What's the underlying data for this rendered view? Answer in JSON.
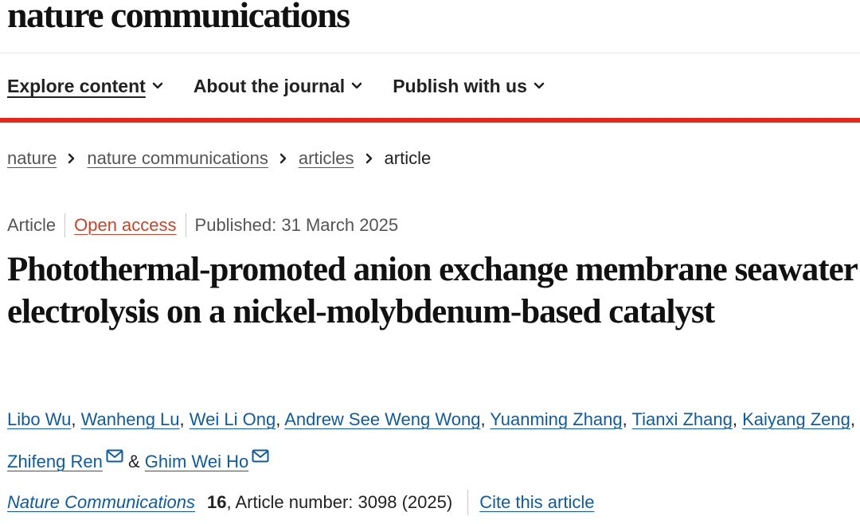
{
  "site": {
    "logo_text": "nature communications"
  },
  "nav": {
    "items": [
      {
        "label": "Explore content",
        "icon": "chevron-down-icon"
      },
      {
        "label": "About the journal",
        "icon": "chevron-down-icon"
      },
      {
        "label": "Publish with us",
        "icon": "chevron-down-icon"
      }
    ]
  },
  "breadcrumb": {
    "items": [
      "nature",
      "nature communications",
      "articles"
    ],
    "current": "article",
    "separator_icon": "chevron-right-icon"
  },
  "article": {
    "type": "Article",
    "access": "Open access",
    "published": "Published: 31 March 2025",
    "title": "Photothermal-promoted anion exchange membrane seawater electrolysis on a nickel-molybdenum-based catalyst",
    "authors": [
      {
        "name": "Libo Wu"
      },
      {
        "name": "Wanheng Lu"
      },
      {
        "name": "Wei Li Ong"
      },
      {
        "name": "Andrew See Weng Wong"
      },
      {
        "name": "Yuanming Zhang"
      },
      {
        "name": "Tianxi Zhang"
      },
      {
        "name": "Kaiyang Zeng"
      },
      {
        "name": "Zhifeng Ren",
        "icon": "mail-icon"
      },
      {
        "name": "Ghim Wei Ho",
        "icon": "mail-icon"
      }
    ],
    "author_separator": ",",
    "author_conjunction": "&",
    "citation": {
      "journal": "Nature Communications",
      "volume": "16",
      "details": ", Article number: 3098 (2025)",
      "cite_label": "Cite this article"
    }
  },
  "colors": {
    "accent_red": "#e4281c",
    "link_blue": "#0f5b9c",
    "open_access_orange": "#c2462b",
    "text_dark": "#222222",
    "text_muted": "#555555"
  }
}
